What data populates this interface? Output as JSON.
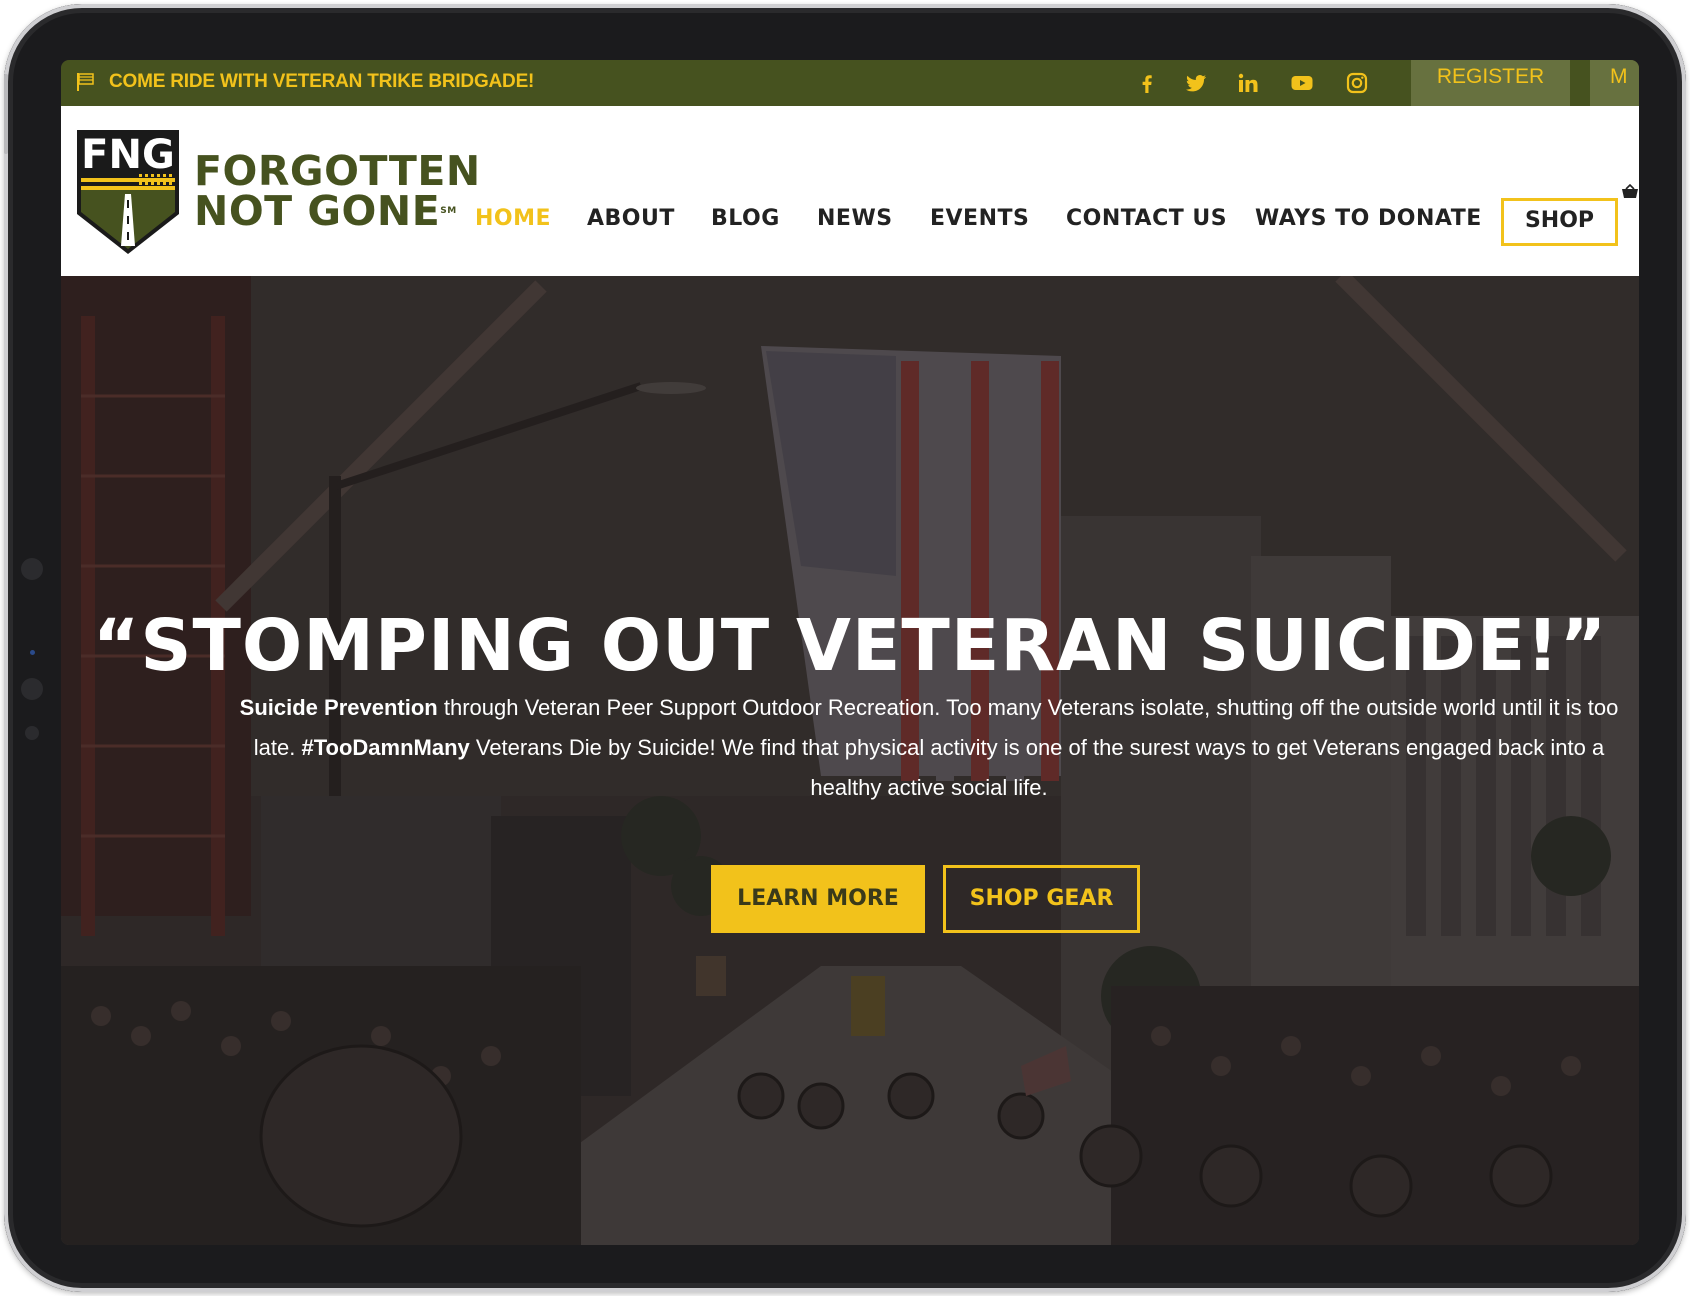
{
  "topbar": {
    "announcement": "COME RIDE WITH VETERAN TRIKE BRIDGADE!",
    "register_label": "REGISTER",
    "menu_stub": "M",
    "social_icons": [
      "facebook-icon",
      "twitter-icon",
      "linkedin-icon",
      "youtube-icon",
      "instagram-icon"
    ]
  },
  "logo": {
    "badge_text": "FNG",
    "line1": "FORGOTTEN",
    "line2": "NOT GONE",
    "mark": "SM"
  },
  "nav": {
    "home": "HOME",
    "about": "ABOUT",
    "blog": "BLOG",
    "news": "NEWS",
    "events": "EVENTS",
    "contact": "CONTACT US",
    "donate": "WAYS TO DONATE",
    "shop": "SHOP"
  },
  "hero": {
    "title": "“STOMPING OUT VETERAN SUICIDE!”",
    "text_bold_1": "Suicide Prevention",
    "text_1": " through Veteran Peer Support Outdoor Recreation. Too many Veterans isolate, shutting off the outside world until it is too late. ",
    "text_bold_2": "#TooDamnMany",
    "text_2": " Veterans Die by Suicide! We find that physical activity is one of the surest ways to get Veterans engaged back into a healthy active social life.",
    "learn_more": "LEARN MORE",
    "shop_gear": "SHOP GEAR"
  },
  "colors": {
    "brand_green": "#46521f",
    "accent_yellow": "#f2c21b",
    "nav_text": "#222222"
  }
}
